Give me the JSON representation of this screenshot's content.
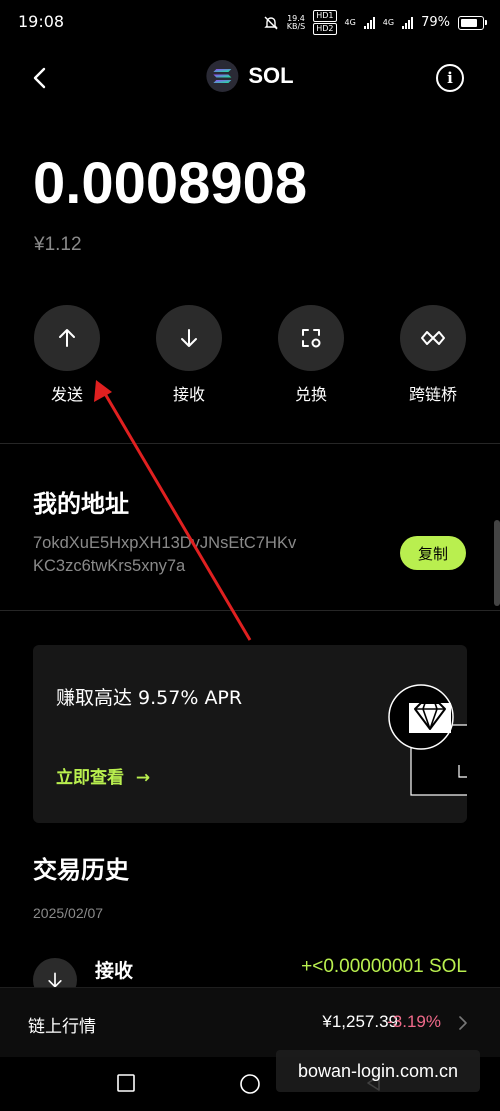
{
  "status_bar": {
    "time": "19:08",
    "speed_value": "19.4",
    "speed_unit": "KB/S",
    "hd1": "HD1",
    "hd2": "HD2",
    "net1": "4G",
    "net2": "4G",
    "battery": "79%"
  },
  "header": {
    "back_icon": "chevron-left-icon",
    "title": "SOL",
    "info_label": "i"
  },
  "balance": {
    "amount": "0.0008908",
    "fiat": "¥1.12"
  },
  "actions": [
    {
      "label": "发送",
      "icon": "arrow-up-icon"
    },
    {
      "label": "接收",
      "icon": "arrow-down-icon"
    },
    {
      "label": "兑换",
      "icon": "swap-icon"
    },
    {
      "label": "跨链桥",
      "icon": "bridge-icon"
    }
  ],
  "address": {
    "title": "我的地址",
    "line1": "7okdXuE5HxpXH13DvJNsEtC7HKv",
    "line2": "KC3zc6twKrs5xny7a",
    "copy_label": "复制"
  },
  "promo": {
    "text": "赚取高达 9.57% APR",
    "link_label": "立即查看",
    "link_arrow": "→"
  },
  "history": {
    "title": "交易历史",
    "date": "2025/02/07",
    "items": [
      {
        "type": "接收",
        "amount": "+<0.00000001 SOL"
      }
    ]
  },
  "market": {
    "label": "链上行情",
    "price": "¥1,257.39",
    "change": "-3.19%"
  },
  "watermark": "bowan-login.com.cn",
  "colors": {
    "accent": "#b9ef4f",
    "negative": "#f06a8a",
    "annotation_arrow": "#e02020"
  }
}
